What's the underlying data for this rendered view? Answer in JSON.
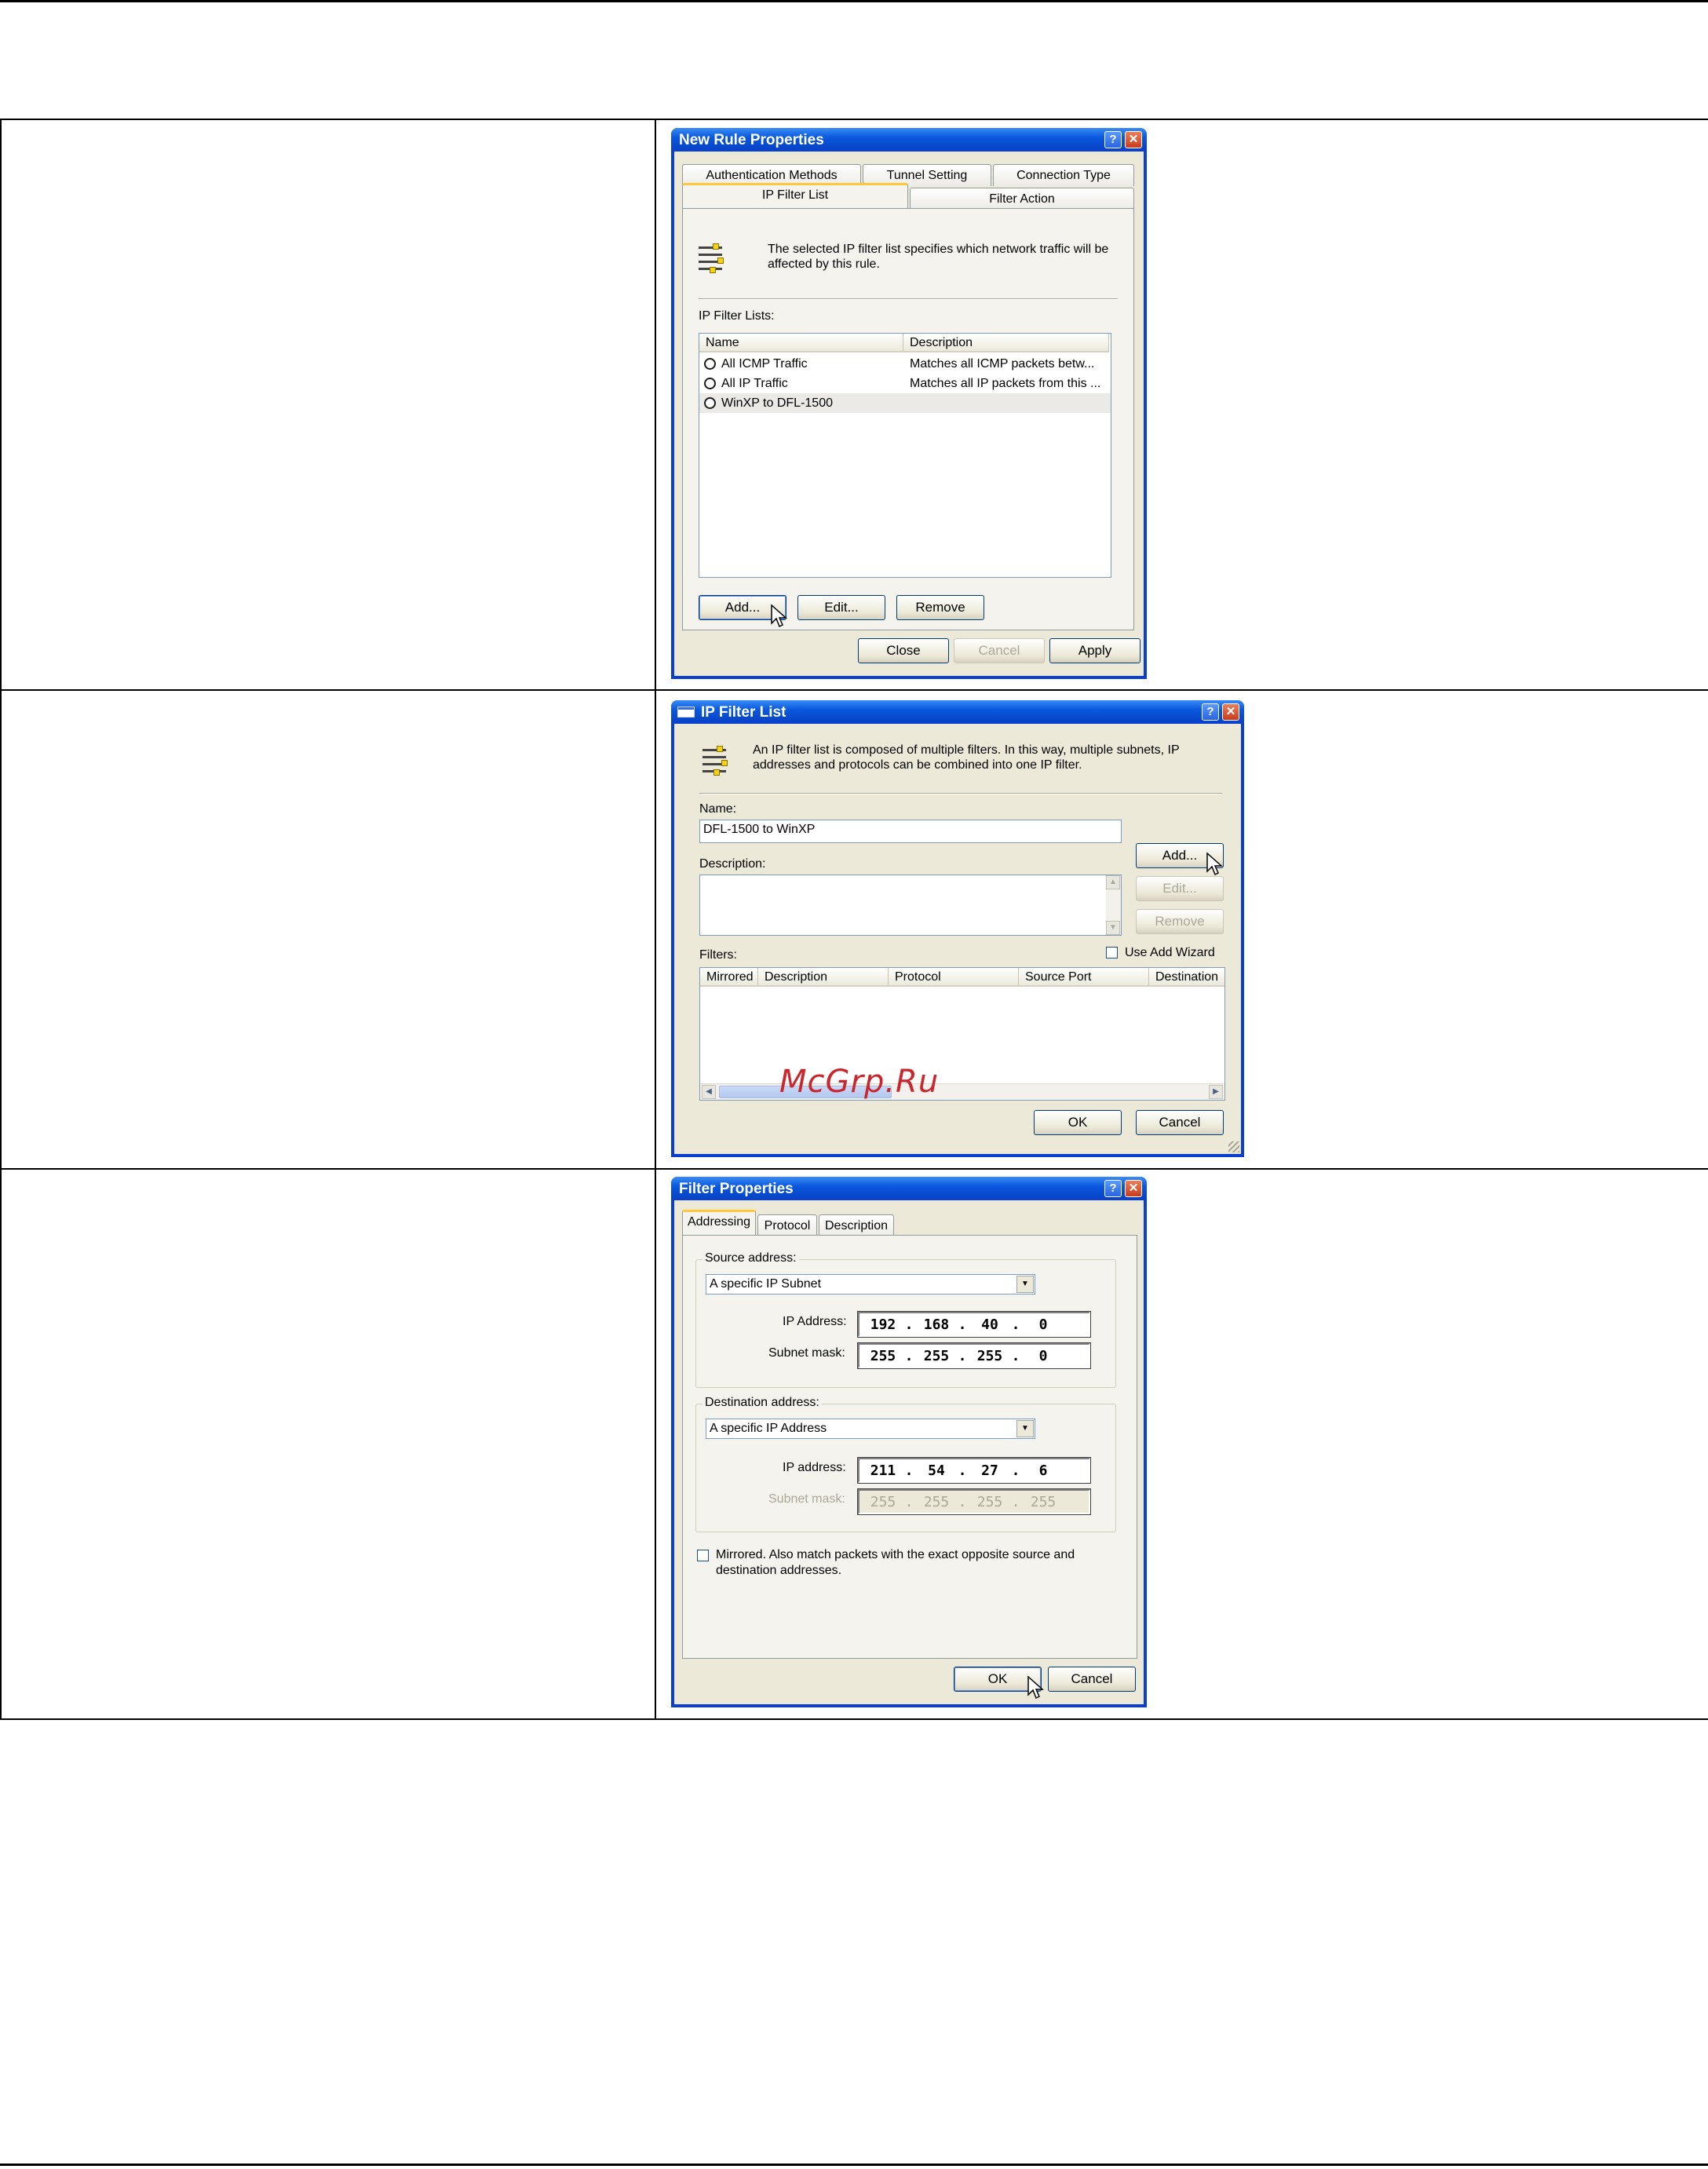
{
  "watermark": "McGrp.Ru",
  "dialog1": {
    "title": "New Rule Properties",
    "tabs_back": [
      "Authentication Methods",
      "Tunnel Setting",
      "Connection Type"
    ],
    "tabs_front": [
      "IP Filter List",
      "Filter Action"
    ],
    "active_tab": "IP Filter List",
    "info": "The selected IP filter list specifies which network traffic will be affected by this rule.",
    "list_label": "IP Filter Lists:",
    "columns": [
      "Name",
      "Description"
    ],
    "rows": [
      {
        "name": "All ICMP Traffic",
        "description": "Matches all ICMP packets betw..."
      },
      {
        "name": "All IP Traffic",
        "description": "Matches all IP packets from this ..."
      },
      {
        "name": "WinXP to DFL-1500",
        "description": ""
      }
    ],
    "buttons": {
      "add": "Add...",
      "edit": "Edit...",
      "remove": "Remove",
      "close": "Close",
      "cancel": "Cancel",
      "apply": "Apply"
    }
  },
  "dialog2": {
    "title": "IP Filter List",
    "info": "An IP filter list is composed of multiple filters. In this way, multiple subnets, IP addresses and protocols can be combined into one IP filter.",
    "name_label": "Name:",
    "name_value": "DFL-1500 to WinXP",
    "description_label": "Description:",
    "description_value": "",
    "filters_label": "Filters:",
    "use_add_wizard": "Use Add Wizard",
    "columns": [
      "Mirrored",
      "Description",
      "Protocol",
      "Source Port",
      "Destination"
    ],
    "buttons": {
      "add": "Add...",
      "edit": "Edit...",
      "remove": "Remove",
      "ok": "OK",
      "cancel": "Cancel"
    }
  },
  "dialog3": {
    "title": "Filter Properties",
    "tabs": [
      "Addressing",
      "Protocol",
      "Description"
    ],
    "active_tab": "Addressing",
    "source": {
      "group_label": "Source address:",
      "type": "A specific IP Subnet",
      "ip_label": "IP Address:",
      "ip": [
        "192",
        "168",
        "40",
        "0"
      ],
      "mask_label": "Subnet mask:",
      "mask": [
        "255",
        "255",
        "255",
        "0"
      ]
    },
    "destination": {
      "group_label": "Destination address:",
      "type": "A specific IP Address",
      "ip_label": "IP address:",
      "ip": [
        "211",
        "54",
        "27",
        "6"
      ],
      "mask_label": "Subnet mask:",
      "mask": [
        "255",
        "255",
        "255",
        "255"
      ]
    },
    "mirrored_text_1": "Mirrored. Also match packets with the exact opposite source and",
    "mirrored_text_2": "destination addresses.",
    "buttons": {
      "ok": "OK",
      "cancel": "Cancel"
    }
  }
}
